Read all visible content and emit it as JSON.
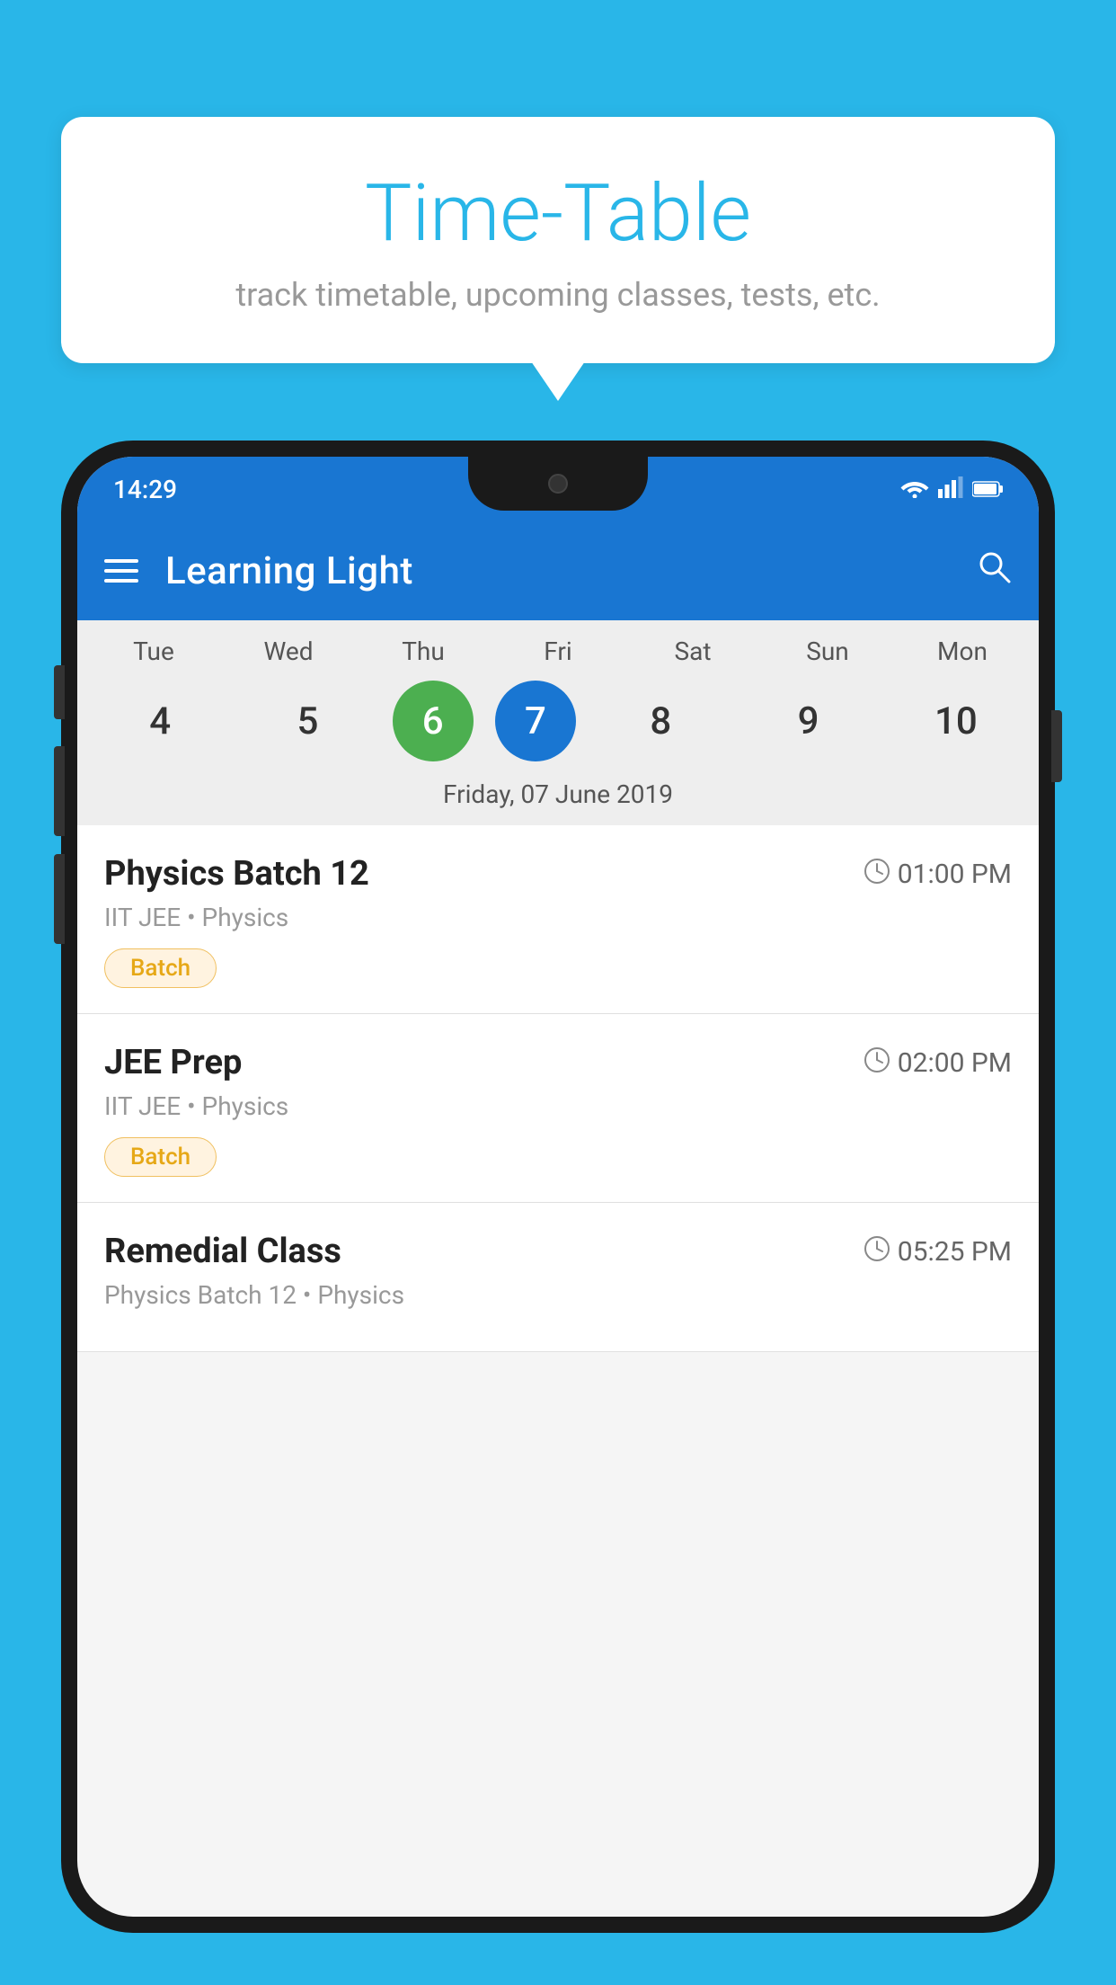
{
  "background_color": "#29b6e8",
  "bubble": {
    "title": "Time-Table",
    "subtitle": "track timetable, upcoming classes, tests, etc."
  },
  "app_bar": {
    "title": "Learning Light"
  },
  "status_bar": {
    "time": "14:29"
  },
  "calendar": {
    "days": [
      {
        "name": "Tue",
        "number": "4",
        "state": "normal"
      },
      {
        "name": "Wed",
        "number": "5",
        "state": "normal"
      },
      {
        "name": "Thu",
        "number": "6",
        "state": "today"
      },
      {
        "name": "Fri",
        "number": "7",
        "state": "selected"
      },
      {
        "name": "Sat",
        "number": "8",
        "state": "normal"
      },
      {
        "name": "Sun",
        "number": "9",
        "state": "normal"
      },
      {
        "name": "Mon",
        "number": "10",
        "state": "normal"
      }
    ],
    "selected_date_label": "Friday, 07 June 2019"
  },
  "schedule_items": [
    {
      "title": "Physics Batch 12",
      "time": "01:00 PM",
      "subtitle": "IIT JEE • Physics",
      "tag": "Batch"
    },
    {
      "title": "JEE Prep",
      "time": "02:00 PM",
      "subtitle": "IIT JEE • Physics",
      "tag": "Batch"
    },
    {
      "title": "Remedial Class",
      "time": "05:25 PM",
      "subtitle": "Physics Batch 12 • Physics",
      "tag": ""
    }
  ]
}
